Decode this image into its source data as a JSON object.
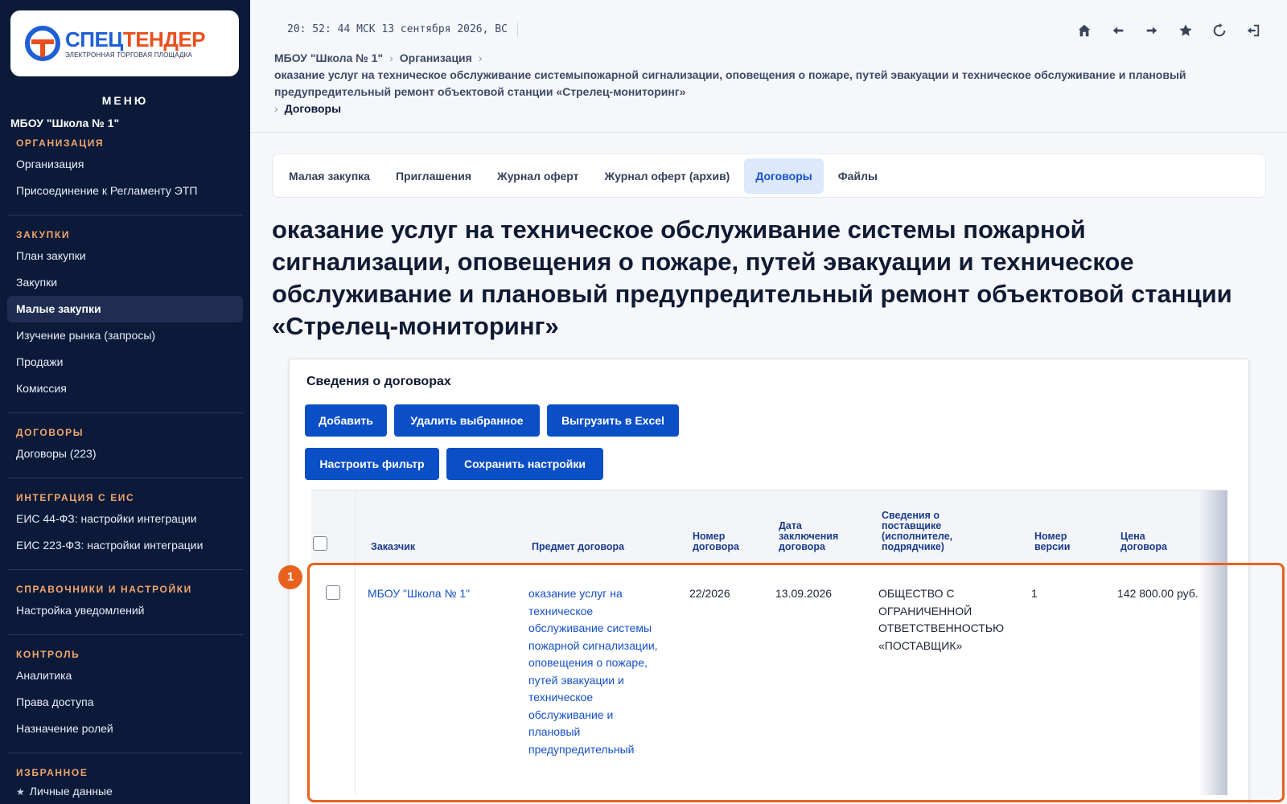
{
  "brand": {
    "name_part1": "СПЕЦ",
    "name_part2": "ТЕНДЕР",
    "subtitle": "ЭЛЕКТРОННАЯ ТОРГОВАЯ ПЛОЩАДКА",
    "color_blue": "#1e5fd6",
    "color_orange": "#e8501e"
  },
  "sidebar": {
    "menu_title": "МЕНЮ",
    "org_name": "МБОУ \"Школа № 1\"",
    "sections": [
      {
        "title": "ОРГАНИЗАЦИЯ",
        "items": [
          "Организация",
          "Присоединение к Регламенту ЭТП"
        ]
      },
      {
        "title": "ЗАКУПКИ",
        "items": [
          "План закупки",
          "Закупки",
          "Малые закупки",
          "Изучение рынка (запросы)",
          "Продажи",
          "Комиссия"
        ]
      },
      {
        "title": "ДОГОВОРЫ",
        "items": [
          "Договоры (223)"
        ]
      },
      {
        "title": "ИНТЕГРАЦИЯ С ЕИС",
        "items": [
          "ЕИС 44-ФЗ: настройки интеграции",
          "ЕИС 223-ФЗ: настройки интеграции"
        ]
      },
      {
        "title": "СПРАВОЧНИКИ И НАСТРОЙКИ",
        "items": [
          "Настройка уведомлений"
        ]
      },
      {
        "title": "КОНТРОЛЬ",
        "items": [
          "Аналитика",
          "Права доступа",
          "Назначение ролей"
        ]
      },
      {
        "title": "ИЗБРАННОЕ",
        "items": [
          "Личные данные"
        ]
      }
    ],
    "active_item": "Малые закупки"
  },
  "topbar": {
    "clock": "20: 52: 44 МСК  13 сентября 2026, ВС",
    "icons": [
      "home-icon",
      "arrow-left-icon",
      "arrow-right-icon",
      "star-icon",
      "refresh-icon",
      "logout-icon"
    ]
  },
  "breadcrumb": {
    "item1": "МБОУ \"Школа № 1\"",
    "item2": "Организация",
    "item3": "оказание услуг на техническое обслуживание системыпожарной сигнализации, оповещения о пожаре, путей эвакуации и техническое обслуживание и плановый предупредительный ремонт объектовой станции «Стрелец-мониторинг»",
    "current": "Договоры"
  },
  "tabs": [
    {
      "label": "Малая закупка",
      "active": false
    },
    {
      "label": "Приглашения",
      "active": false
    },
    {
      "label": "Журнал оферт",
      "active": false
    },
    {
      "label": "Журнал оферт (архив)",
      "active": false
    },
    {
      "label": "Договоры",
      "active": true
    },
    {
      "label": "Файлы",
      "active": false
    }
  ],
  "page_title": "оказание услуг на техническое обслуживание системы пожарной сигнализации, оповещения о пожаре, путей эвакуации и техническое обслуживание и плановый предупредительный ремонт объектовой станции «Стрелец-мониторинг»",
  "contracts": {
    "title": "Сведения о договорах",
    "buttons": {
      "add": "Добавить",
      "delete_selected": "Удалить выбранное",
      "export_excel": "Выгрузить в Excel",
      "filter": "Настроить фильтр",
      "save_settings": "Сохранить настройки"
    },
    "columns": {
      "customer": "Заказчик",
      "subject": "Предмет договора",
      "number": "Номер договора",
      "date": "Дата заключения договора",
      "supplier": "Сведения о поставщике (исполнителе, подрядчике)",
      "version": "Номер версии",
      "price": "Цена договора"
    },
    "rows": [
      {
        "customer": "МБОУ \"Школа № 1\"",
        "subject": "оказание услуг на техническое обслуживание системы пожарной сигнализации, оповещения о пожаре, путей эвакуации и техническое обслуживание и плановый предупредительный",
        "number": "22/2026",
        "date": "13.09.2026",
        "supplier": "ОБЩЕСТВО С ОГРАНИЧЕННОЙ ОТВЕТСТВЕННОСТЬЮ «ПОСТАВЩИК»",
        "version": "1",
        "price": "142 800.00 руб."
      }
    ]
  },
  "annotation": {
    "label": "1",
    "color": "#e8621e"
  }
}
